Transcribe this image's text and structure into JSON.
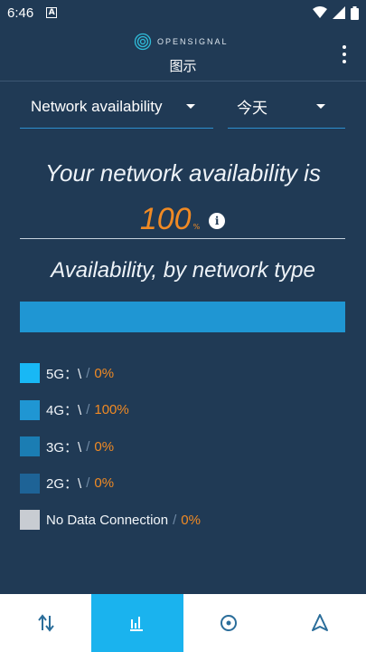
{
  "status_bar": {
    "time": "6:46",
    "badge": "A"
  },
  "header": {
    "logo_text": "OPENSIGNAL",
    "title": "图示"
  },
  "filters": {
    "network": "Network availability",
    "period": "今天"
  },
  "summary": {
    "headline": "Your network availability is",
    "value": "100",
    "unit": "%"
  },
  "breakdown_title": "Availability, by network type",
  "legend": [
    {
      "label": "5G：\\",
      "value": "0%",
      "color": "#18b8f5",
      "fraction": 0
    },
    {
      "label": "4G：\\",
      "value": "100%",
      "color": "#1f96d3",
      "fraction": 1
    },
    {
      "label": "3G：\\",
      "value": "0%",
      "color": "#1b7db3",
      "fraction": 0
    },
    {
      "label": "2G：\\",
      "value": "0%",
      "color": "#1e6396",
      "fraction": 0
    },
    {
      "label": "No Data Connection",
      "value": "0%",
      "color": "#c8ccd2",
      "fraction": 0
    }
  ],
  "colors": {
    "accent": "#f08a24",
    "background": "#203a55",
    "nav_active": "#1ab3ee"
  },
  "bottom_nav": [
    {
      "icon": "transfer-arrows-icon",
      "active": false
    },
    {
      "icon": "bar-chart-icon",
      "active": true
    },
    {
      "icon": "location-pin-icon",
      "active": false
    },
    {
      "icon": "navigation-arrow-icon",
      "active": false
    }
  ]
}
